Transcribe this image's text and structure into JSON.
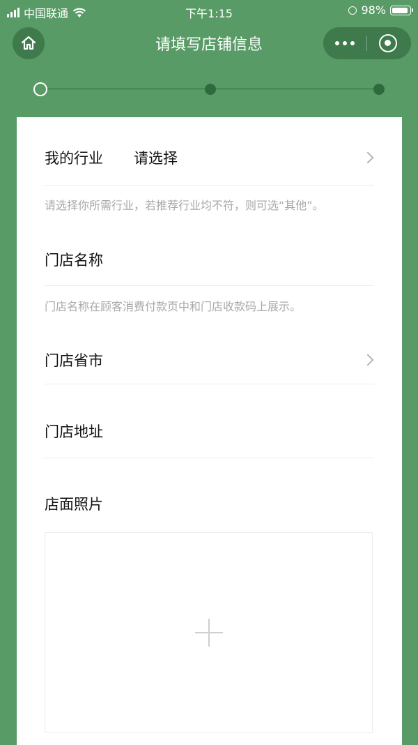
{
  "status_bar": {
    "carrier": "中国联通",
    "time": "下午1:15",
    "battery": "98%"
  },
  "nav": {
    "title": "请填写店铺信息",
    "home_icon": "home-icon",
    "more_icon": "more-dots-icon",
    "close_icon": "target-icon"
  },
  "steps": {
    "total": 3,
    "current": 1
  },
  "form": {
    "industry": {
      "label": "我的行业",
      "value": "请选择",
      "hint": "请选择你所需行业，若推荐行业均不符，则可选“其他”。"
    },
    "store_name": {
      "label": "门店名称",
      "hint": "门店名称在顾客消费付款页中和门店收款码上展示。"
    },
    "province_city": {
      "label": "门店省市"
    },
    "address": {
      "label": "门店地址"
    },
    "photo": {
      "label": "店面照片",
      "upload_icon": "plus-icon"
    }
  },
  "colors": {
    "brand_green": "#589b66",
    "dark_green": "#3f7a4c",
    "step_green": "#2f6a3c"
  }
}
